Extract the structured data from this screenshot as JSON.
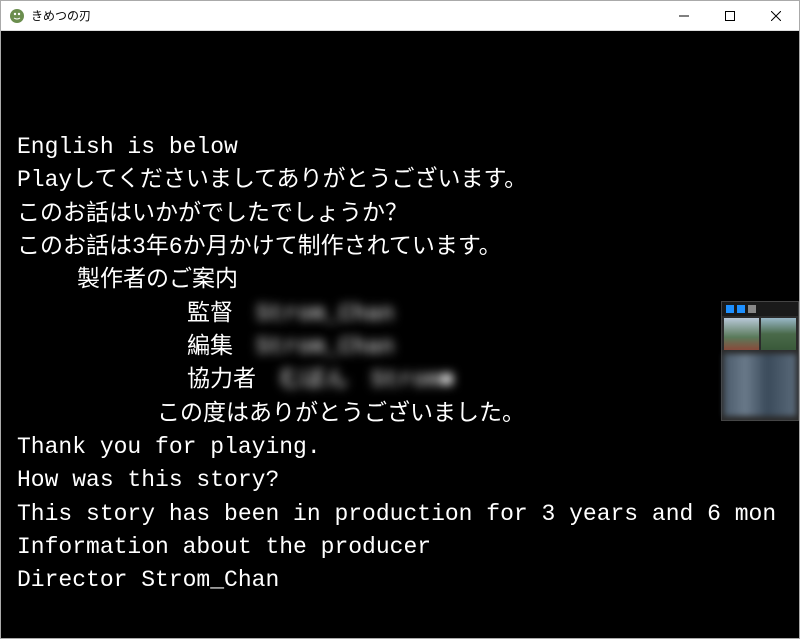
{
  "window": {
    "title": "きめつの刃"
  },
  "credits": {
    "lines": [
      "English is below",
      "Playしてくださいましてありがとうございます。",
      "このお話はいかがでしたでしょうか？",
      "このお話は3年6か月かけて制作されています。"
    ],
    "producer_heading": "製作者のご案内",
    "roles": {
      "director_label": "監督",
      "director_name": "Strom_Chan",
      "editor_label": "編集",
      "editor_name": "Strom_Chan",
      "collaborator_label": "協力者",
      "collaborator_name": "むぼん　Strom■"
    },
    "thanks": "この度はありがとうございました。",
    "english": [
      "Thank you for playing.",
      "How was this story?",
      "This story has been in production for 3 years and 6 mon",
      "Information about the producer",
      "Director Strom_Chan"
    ]
  }
}
